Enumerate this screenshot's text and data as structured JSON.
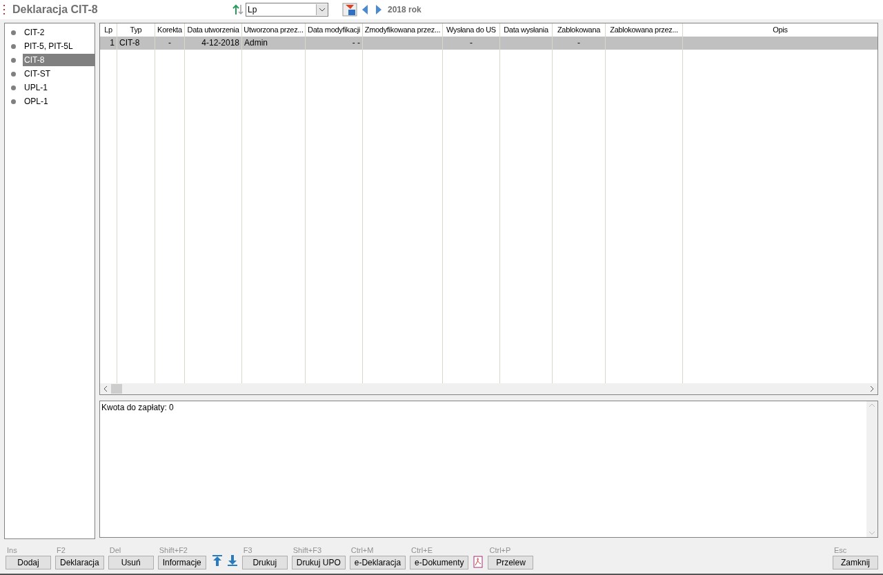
{
  "window": {
    "title": "Deklaracja CIT-8"
  },
  "toolbar": {
    "sort_field": "Lp",
    "period": "2018 rok"
  },
  "sidebar": {
    "items": [
      {
        "label": "CIT-2",
        "selected": false
      },
      {
        "label": "PIT-5, PIT-5L",
        "selected": false
      },
      {
        "label": "CIT-8",
        "selected": true
      },
      {
        "label": "CIT-ST",
        "selected": false
      },
      {
        "label": "UPL-1",
        "selected": false
      },
      {
        "label": "OPL-1",
        "selected": false
      }
    ]
  },
  "table": {
    "columns": [
      "Lp",
      "Typ",
      "Korekta",
      "Data utworzenia",
      "Utworzona przez...",
      "Data modyfikacji",
      "Zmodyfikowana przez...",
      "Wysłana do US",
      "Data wysłania",
      "Zablokowana",
      "Zablokowana przez...",
      "Opis"
    ],
    "rows": [
      {
        "selected": true,
        "cells": [
          "1",
          "CIT-8",
          "-",
          "4-12-2018",
          "Admin",
          "- -",
          "",
          "-",
          "",
          "-",
          "",
          ""
        ]
      }
    ]
  },
  "details": {
    "text": "Kwota do zapłaty: 0"
  },
  "buttons": [
    {
      "kind": "button",
      "shortcut": "Ins",
      "label": "Dodaj"
    },
    {
      "kind": "button",
      "shortcut": "F2",
      "label": "Deklaracja"
    },
    {
      "kind": "button",
      "shortcut": "Del",
      "label": "Usuń"
    },
    {
      "kind": "button",
      "shortcut": "Shift+F2",
      "label": "Informacje"
    },
    {
      "kind": "up"
    },
    {
      "kind": "down"
    },
    {
      "kind": "button",
      "shortcut": "F3",
      "label": "Drukuj"
    },
    {
      "kind": "button",
      "shortcut": "Shift+F3",
      "label": "Drukuj UPO"
    },
    {
      "kind": "button",
      "shortcut": "Ctrl+M",
      "label": "e-Deklaracja"
    },
    {
      "kind": "button",
      "shortcut": "Ctrl+E",
      "label": "e-Dokumenty"
    },
    {
      "kind": "pdf"
    },
    {
      "kind": "button",
      "shortcut": "Ctrl+P",
      "label": "Przelew"
    },
    {
      "kind": "close",
      "shortcut": "Esc",
      "label": "Zamknij"
    }
  ]
}
